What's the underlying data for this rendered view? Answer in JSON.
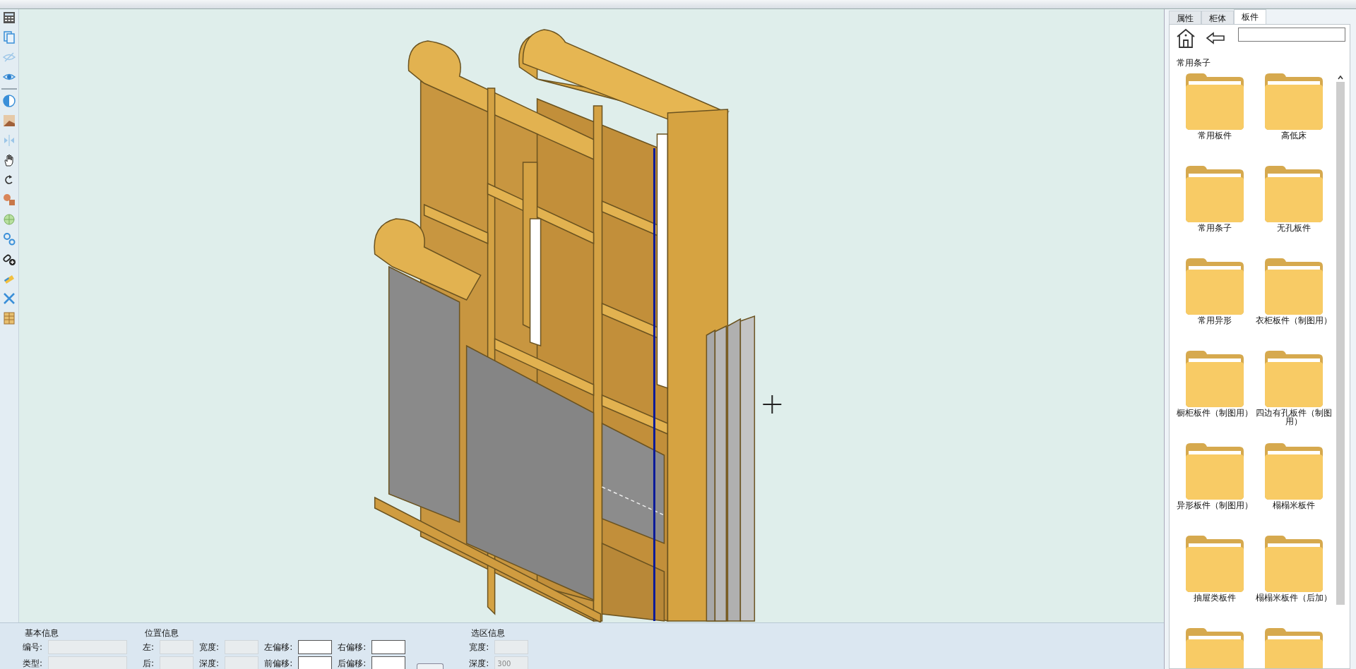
{
  "right_panel": {
    "tabs": [
      {
        "label": "属性",
        "selected": false
      },
      {
        "label": "柜体",
        "selected": false
      },
      {
        "label": "板件",
        "selected": true
      }
    ],
    "section_title": "常用条子",
    "folders": [
      {
        "label": "常用板件"
      },
      {
        "label": "高低床"
      },
      {
        "label": "常用条子"
      },
      {
        "label": "无孔板件"
      },
      {
        "label": "常用异形"
      },
      {
        "label": "衣柜板件（制图用）"
      },
      {
        "label": "橱柜板件（制图用）"
      },
      {
        "label": "四边有孔板件（制图用）"
      },
      {
        "label": "异形板件（制图用）"
      },
      {
        "label": "榻榻米板件"
      },
      {
        "label": "抽屉类板件"
      },
      {
        "label": "榻榻米板件（后加）"
      },
      {
        "kind": "folder"
      },
      {
        "kind": "folder"
      }
    ]
  },
  "bottom_panel": {
    "basic_info": {
      "title": "基本信息",
      "fields": [
        {
          "label": "编号:",
          "disabled": true
        },
        {
          "label": "类型:",
          "disabled": true
        }
      ]
    },
    "position_info": {
      "title": "位置信息",
      "fields": [
        {
          "label": "左:",
          "disabled": true
        },
        {
          "label": "宽度:",
          "disabled": true
        },
        {
          "label": "左偏移:",
          "disabled": false
        },
        {
          "label": "右偏移:",
          "disabled": false
        },
        {
          "label": "后:",
          "disabled": true
        },
        {
          "label": "深度:",
          "disabled": true
        },
        {
          "label": "前偏移:",
          "disabled": false
        },
        {
          "label": "后偏移:",
          "disabled": false
        }
      ]
    },
    "selection_info": {
      "title": "选区信息",
      "fields": [
        {
          "label": "宽度:",
          "disabled": true
        },
        {
          "label": "深度:",
          "disabled": true,
          "value": "300"
        }
      ]
    }
  }
}
